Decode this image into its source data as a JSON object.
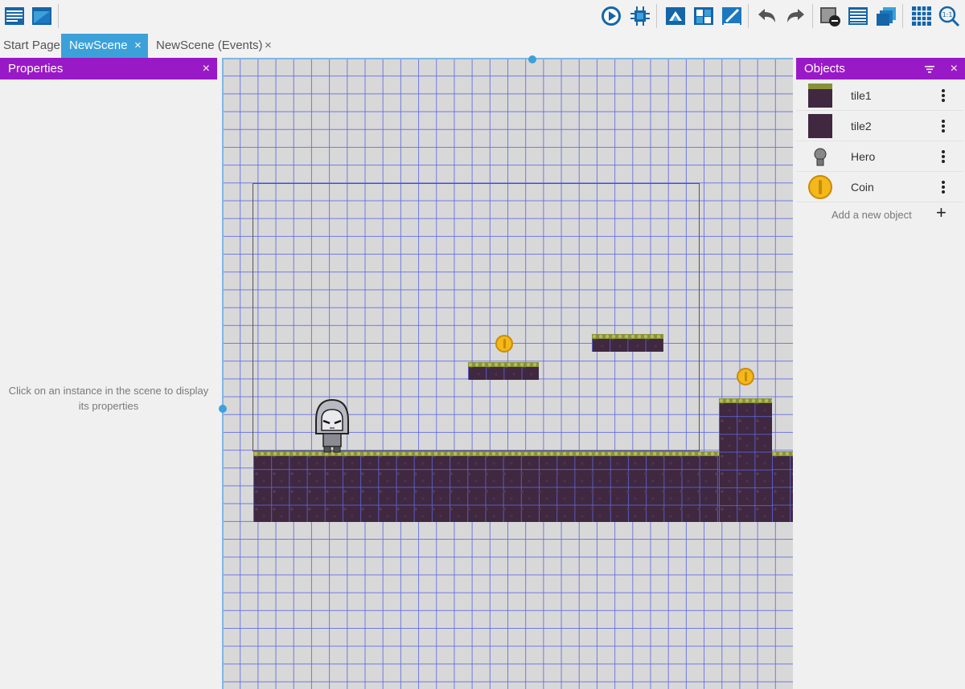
{
  "toolbar": {
    "left_buttons": [
      "project-manager-icon",
      "scene-list-icon"
    ],
    "right_buttons": [
      "preview-icon",
      "debug-icon",
      "layer-editor-icon",
      "instances-icon",
      "object-editor-icon",
      "undo-icon",
      "redo-icon",
      "scene-properties-icon",
      "instances-list-icon",
      "layers-icon",
      "grid-icon",
      "zoom-icon"
    ],
    "zoom_label": "1:1"
  },
  "tabs": [
    {
      "label": "Start Page",
      "active": false,
      "closable": false
    },
    {
      "label": "NewScene",
      "active": true,
      "closable": true
    },
    {
      "label": "NewScene (Events)",
      "active": false,
      "closable": true
    }
  ],
  "tab_close_glyph": "×",
  "properties": {
    "title": "Properties",
    "close_glyph": "×",
    "empty_message": "Click on an instance in the scene to display its properties"
  },
  "objects": {
    "title": "Objects",
    "close_glyph": "×",
    "items": [
      {
        "name": "tile1",
        "icon": "tile1-thumbnail"
      },
      {
        "name": "tile2",
        "icon": "tile2-thumbnail"
      },
      {
        "name": "Hero",
        "icon": "hero-thumbnail"
      },
      {
        "name": "Coin",
        "icon": "coin-thumbnail"
      }
    ],
    "add_label": "Add a new object",
    "add_glyph": "+"
  },
  "colors": {
    "accent_tab": "#3da1d9",
    "panel_header": "#9a19c7",
    "grid_line": "#5f69e1",
    "ground": "#3f2840",
    "grass": "#87913a",
    "coin": "#f3b81a"
  }
}
